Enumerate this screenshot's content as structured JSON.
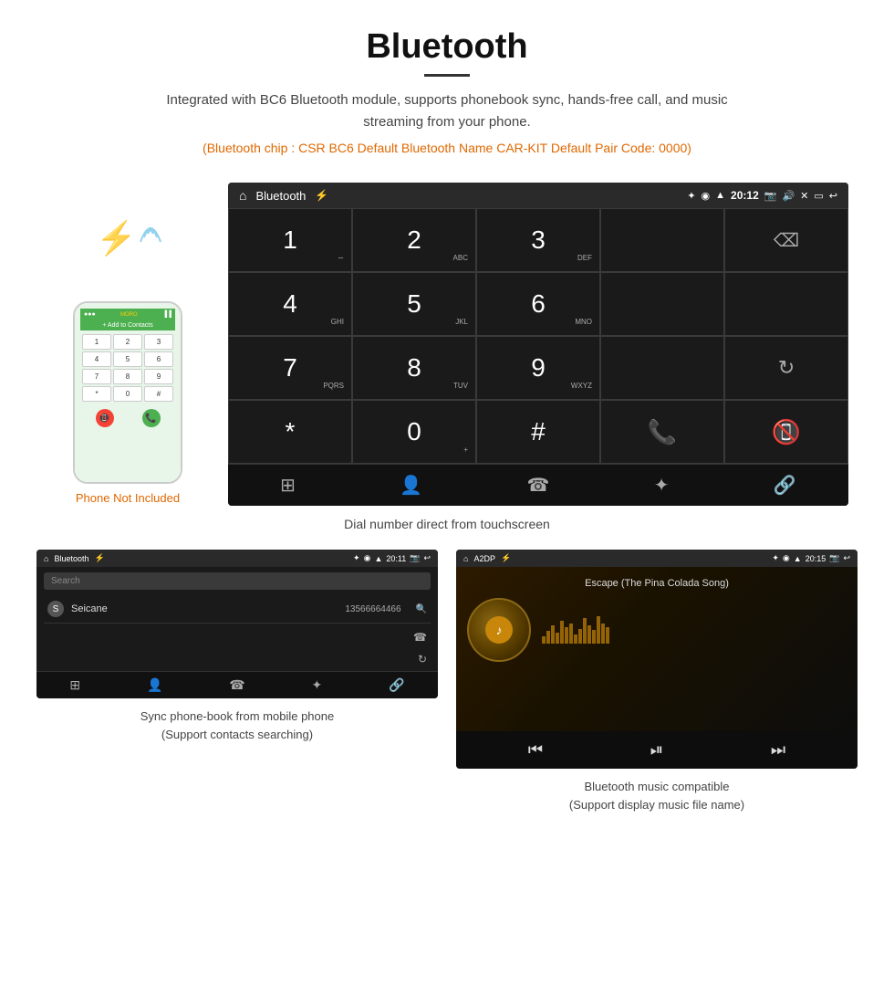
{
  "header": {
    "title": "Bluetooth",
    "description": "Integrated with BC6 Bluetooth module, supports phonebook sync, hands-free call, and music streaming from your phone.",
    "specs": "(Bluetooth chip : CSR BC6    Default Bluetooth Name CAR-KIT    Default Pair Code: 0000)"
  },
  "car_screen": {
    "status_bar": {
      "title": "Bluetooth",
      "time": "20:12"
    },
    "dialpad": {
      "keys": [
        {
          "num": "1",
          "sub": ""
        },
        {
          "num": "2",
          "sub": "ABC"
        },
        {
          "num": "3",
          "sub": "DEF"
        },
        {
          "num": "",
          "sub": ""
        },
        {
          "num": "",
          "sub": "",
          "action": "backspace"
        },
        {
          "num": "4",
          "sub": "GHI"
        },
        {
          "num": "5",
          "sub": "JKL"
        },
        {
          "num": "6",
          "sub": "MNO"
        },
        {
          "num": "",
          "sub": ""
        },
        {
          "num": "",
          "sub": ""
        },
        {
          "num": "7",
          "sub": "PQRS"
        },
        {
          "num": "8",
          "sub": "TUV"
        },
        {
          "num": "9",
          "sub": "WXYZ"
        },
        {
          "num": "",
          "sub": "",
          "action": "refresh"
        },
        {
          "num": "",
          "sub": ""
        },
        {
          "num": "*",
          "sub": ""
        },
        {
          "num": "0",
          "sub": "+"
        },
        {
          "num": "#",
          "sub": ""
        },
        {
          "num": "",
          "sub": "",
          "action": "call_green"
        },
        {
          "num": "",
          "sub": "",
          "action": "call_red"
        }
      ]
    },
    "toolbar": {
      "icons": [
        "grid",
        "person",
        "phone",
        "bluetooth",
        "link"
      ]
    }
  },
  "dial_caption": "Dial number direct from touchscreen",
  "bottom_left": {
    "status_bar": {
      "title": "Bluetooth",
      "time": "20:11"
    },
    "search_placeholder": "Search",
    "contact": {
      "letter": "S",
      "name": "Seicane",
      "number": "13566664466"
    },
    "caption_line1": "Sync phone-book from mobile phone",
    "caption_line2": "(Support contacts searching)"
  },
  "bottom_right": {
    "status_bar": {
      "title": "A2DP",
      "time": "20:15"
    },
    "song_title": "Escape (The Pina Colada Song)",
    "caption_line1": "Bluetooth music compatible",
    "caption_line2": "(Support display music file name)"
  },
  "phone_label": "Phone Not Included"
}
